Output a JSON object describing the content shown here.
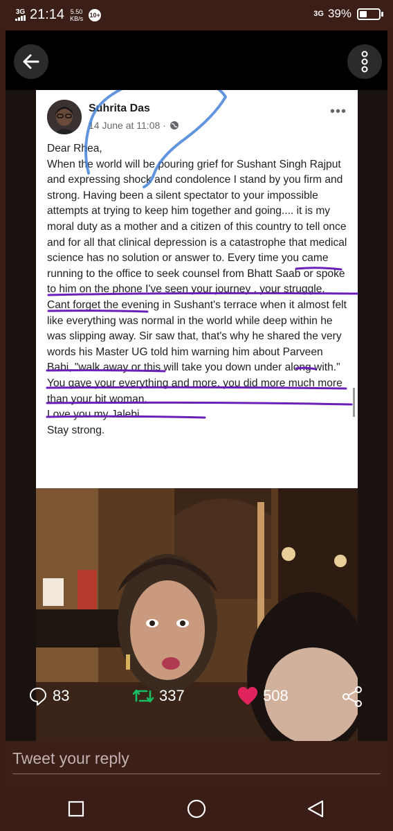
{
  "status_bar": {
    "network": "3G",
    "time": "21:14",
    "speed_value": "5.50",
    "speed_unit": "KB/s",
    "notification_badge": "10+",
    "network_right": "3G",
    "battery_percent": "39%",
    "battery_level": 0.39
  },
  "appbar": {
    "back_icon": "arrow-left-icon",
    "more_icon": "vertical-ellipsis-icon"
  },
  "post": {
    "author": "Suhrita Das",
    "date": "14 June at 11:08 ·",
    "paragraphs": [
      "Dear Rhea,",
      "When the world will be pouring grief for Sushant Singh Rajput and expressing shock and condolence I stand by you firm and strong. Having been a silent spectator to your impossible attempts at trying to keep him together and going.... it is my moral duty as a mother and a citizen of this country to tell once and for all that clinical depression is a catastrophe that medical science has no solution or answer to. Every time you came running to the office to seek counsel from Bhatt Saab or spoke to him on the phone I've seen your journey , your struggle. Cant forget the evening in Sushant's terrace when it almost felt like everything was normal in the world while deep within he was slipping away. Sir saw that, that's why he shared the very words his Master UG told him warning him about Parveen Babi, \"walk away or this will take you down under along with.\"",
      "You gave your everything and more, you did more much more than your bit woman.",
      "Love you my Jalebi.",
      "Stay strong."
    ]
  },
  "actions": {
    "reply_count": "83",
    "retweet_count": "337",
    "like_count": "508"
  },
  "reply": {
    "placeholder": "Tweet your reply"
  },
  "colors": {
    "background": "#3a1d17",
    "like": "#e0245e",
    "retweet": "#17bf63",
    "annotation": "#6a1fb8"
  }
}
